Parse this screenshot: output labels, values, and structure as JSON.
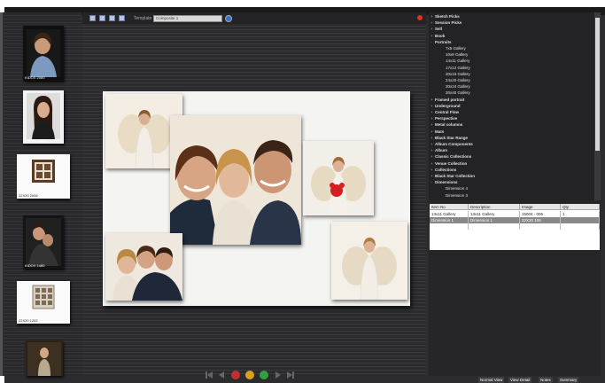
{
  "left_strip": {
    "thumbnails": [
      {
        "label": "KIDOX 2060"
      },
      {
        "label": "KIDOX 2050"
      },
      {
        "label": "22X20 2006"
      },
      {
        "label": "KIDOX 1480"
      },
      {
        "label": "22X20 1202"
      },
      {
        "label": ""
      }
    ]
  },
  "toolbar": {
    "template_label": "Template",
    "template_value": "Composite 1"
  },
  "tree": {
    "items": [
      {
        "label": "Sketch Picks",
        "level": 0,
        "expander": "+"
      },
      {
        "label": "Session Picks",
        "level": 0,
        "expander": "+"
      },
      {
        "label": "Sell",
        "level": 0,
        "expander": "+"
      },
      {
        "label": "Book",
        "level": 0,
        "expander": "+"
      },
      {
        "label": "Portraits",
        "level": 0,
        "expander": "-"
      },
      {
        "label": "7x5 Gallery",
        "level": 2,
        "expander": ""
      },
      {
        "label": "10x8 Gallery",
        "level": 2,
        "expander": ""
      },
      {
        "label": "14x11 Gallery",
        "level": 2,
        "expander": ""
      },
      {
        "label": "17x12 Gallery",
        "level": 2,
        "expander": ""
      },
      {
        "label": "20x16 Gallery",
        "level": 2,
        "expander": ""
      },
      {
        "label": "24x20 Gallery",
        "level": 2,
        "expander": ""
      },
      {
        "label": "30x24 Gallery",
        "level": 2,
        "expander": ""
      },
      {
        "label": "30x40 Gallery",
        "level": 2,
        "expander": ""
      },
      {
        "label": "Framed portrait",
        "level": 0,
        "expander": "+"
      },
      {
        "label": "Underground",
        "level": 0,
        "expander": "+"
      },
      {
        "label": "Central Flow",
        "level": 0,
        "expander": "+"
      },
      {
        "label": "Perspective",
        "level": 0,
        "expander": "+"
      },
      {
        "label": "Metal columns",
        "level": 0,
        "expander": "+"
      },
      {
        "label": "Mats",
        "level": 0,
        "expander": "+"
      },
      {
        "label": "Black Star Range",
        "level": 0,
        "expander": "+"
      },
      {
        "label": "Album Components",
        "level": 0,
        "expander": "+"
      },
      {
        "label": "Album",
        "level": 0,
        "expander": "+"
      },
      {
        "label": "Classic Collections",
        "level": 0,
        "expander": "+"
      },
      {
        "label": "Venue Collection",
        "level": 0,
        "expander": "+"
      },
      {
        "label": "Collections",
        "level": 0,
        "expander": "+"
      },
      {
        "label": "Black Star Collection",
        "level": 0,
        "expander": "+"
      },
      {
        "label": "Dimensions",
        "level": 0,
        "expander": "-"
      },
      {
        "label": "Dimension 4",
        "level": 2,
        "expander": ""
      },
      {
        "label": "Dimension 3",
        "level": 2,
        "expander": ""
      }
    ]
  },
  "table": {
    "columns": [
      "Item No",
      "Description",
      "Image",
      "Qty"
    ],
    "rows": [
      {
        "cells": [
          "13x11 Gallery",
          "13x11 Gallery",
          "15004 - 006",
          "1"
        ],
        "selected": false
      },
      {
        "cells": [
          "Dimension 1",
          "Dimension 1",
          "22X20 106",
          ""
        ],
        "selected": true
      },
      {
        "cells": [
          "",
          "",
          "",
          ""
        ],
        "selected": false
      }
    ]
  },
  "bottom_tabs": [
    "Normal View",
    "View Detail",
    "Notes",
    "Summary"
  ],
  "colors": {
    "panel_bg": "#2c2c2e",
    "canvas_bg": "#f4f4f2",
    "player_red": "#c03030",
    "player_yellow": "#d8a020",
    "player_green": "#30a040",
    "close_red": "#e03020"
  }
}
